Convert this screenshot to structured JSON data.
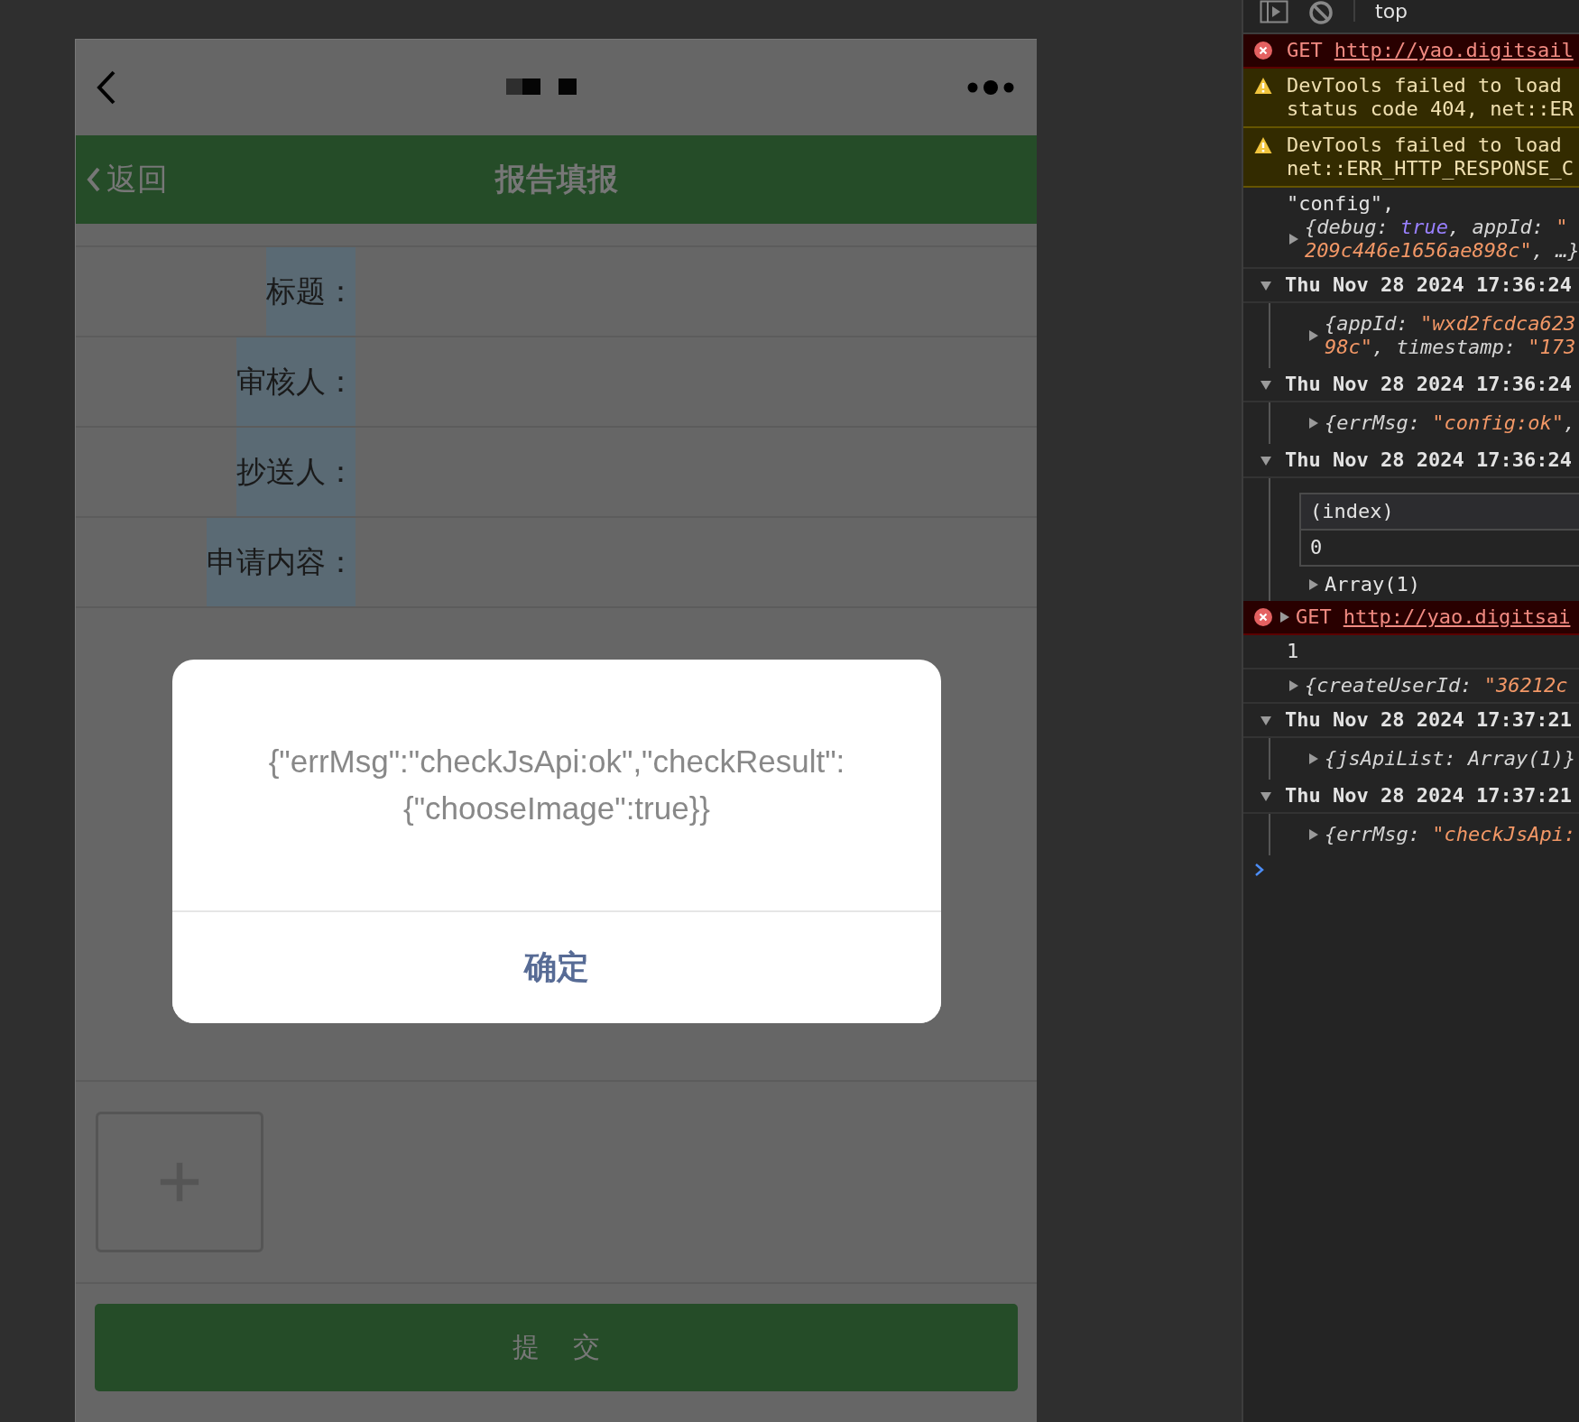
{
  "header": {
    "back": "返回",
    "title": "报告填报"
  },
  "form": {
    "fields": [
      {
        "label": "标题："
      },
      {
        "label": "审核人："
      },
      {
        "label": "抄送人："
      },
      {
        "label": "申请内容："
      }
    ]
  },
  "submit": "提 交",
  "dialog": {
    "message_lines": [
      "{\"errMsg\":\"checkJsApi:ok\",\"checkResult\":",
      "{\"chooseImage\":true}}"
    ],
    "button": "确定"
  },
  "devtools": {
    "toolbar": {
      "context": "top"
    },
    "entries": [
      {
        "kind": "error",
        "method": "GET",
        "url": "http://yao.digitsail"
      },
      {
        "kind": "warning",
        "lines": [
          "DevTools failed to load",
          "status code 404, net::ER"
        ]
      },
      {
        "kind": "warning",
        "lines": [
          "DevTools failed to load",
          "net::ERR_HTTP_RESPONSE_C"
        ]
      },
      {
        "kind": "log",
        "text": "\"config\",",
        "object": {
          "expanded": false,
          "lines": [
            [
              {
                "kind": "punct",
                "text": "{debug: "
              },
              {
                "kind": "bool",
                "text": "true"
              },
              {
                "kind": "punct",
                "text": ", appId: "
              },
              {
                "kind": "string",
                "text": "\""
              }
            ],
            [
              {
                "kind": "string",
                "text": "209c446e1656ae898c\""
              },
              {
                "kind": "punct",
                "text": ", …}"
              }
            ]
          ]
        }
      },
      {
        "kind": "group",
        "expanded": true,
        "title": "Thu Nov 28 2024 17:36:24",
        "children": [
          {
            "kind": "object",
            "expanded": false,
            "lines": [
              [
                {
                  "kind": "punct",
                  "text": "{appId: "
                },
                {
                  "kind": "string",
                  "text": "\"wxd2fcdca623"
                }
              ],
              [
                {
                  "kind": "string",
                  "text": "98c\""
                },
                {
                  "kind": "punct",
                  "text": ", timestamp: "
                },
                {
                  "kind": "string",
                  "text": "\"173"
                }
              ]
            ]
          }
        ]
      },
      {
        "kind": "group",
        "expanded": true,
        "title": "Thu Nov 28 2024 17:36:24",
        "children": [
          {
            "kind": "object",
            "expanded": false,
            "lines": [
              [
                {
                  "kind": "punct",
                  "text": "{errMsg: "
                },
                {
                  "kind": "string",
                  "text": "\"config:ok\""
                },
                {
                  "kind": "punct",
                  "text": ","
                }
              ]
            ]
          }
        ]
      },
      {
        "kind": "group",
        "expanded": true,
        "title": "Thu Nov 28 2024 17:36:24",
        "children": [
          {
            "kind": "table",
            "header": "(index)",
            "rows": [
              "0"
            ]
          },
          {
            "kind": "summary",
            "expanded": false,
            "text": "Array(1)"
          }
        ]
      },
      {
        "kind": "error",
        "method": "GET",
        "url": "http://yao.digitsai",
        "expanded": false
      },
      {
        "kind": "log",
        "text": "1"
      },
      {
        "kind": "object",
        "expanded": false,
        "lines": [
          [
            {
              "kind": "punct",
              "text": "{createUserId: "
            },
            {
              "kind": "string",
              "text": "\"36212c"
            }
          ]
        ]
      },
      {
        "kind": "group",
        "expanded": true,
        "title": "Thu Nov 28 2024 17:37:21",
        "children": [
          {
            "kind": "object",
            "expanded": false,
            "lines": [
              [
                {
                  "kind": "punct",
                  "text": "{jsApiList: Array(1)}"
                }
              ]
            ]
          }
        ]
      },
      {
        "kind": "group",
        "expanded": true,
        "title": "Thu Nov 28 2024 17:37:21",
        "children": [
          {
            "kind": "object",
            "expanded": false,
            "lines": [
              [
                {
                  "kind": "punct",
                  "text": "{errMsg: "
                },
                {
                  "kind": "string",
                  "text": "\"checkJsApi:"
                }
              ]
            ]
          }
        ]
      }
    ]
  }
}
